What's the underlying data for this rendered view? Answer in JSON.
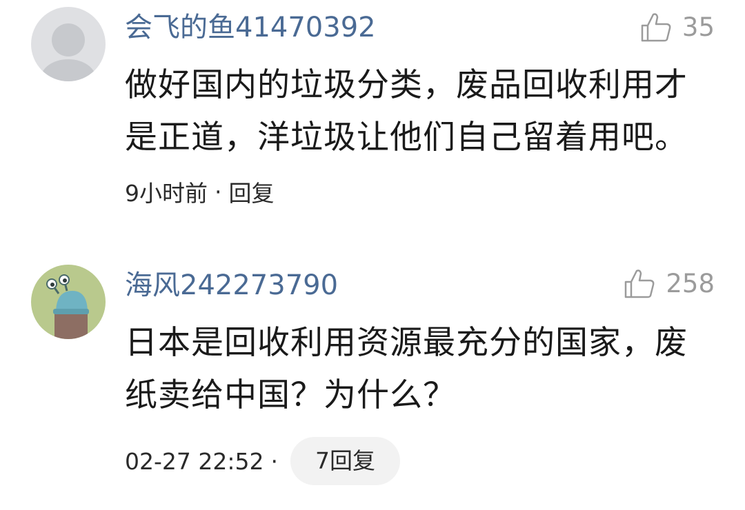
{
  "comments": [
    {
      "username": "会飞的鱼41470392",
      "likes": "35",
      "text_lines": [
        "做好国内的垃圾分类，废品回收利用才",
        "是正道，洋垃圾让他们自己留着用吧。"
      ],
      "time": "9小时前",
      "dot": "·",
      "reply_label": "回复",
      "avatar_icon": "default-avatar-icon"
    },
    {
      "username": "海风242273790",
      "likes": "258",
      "text_lines": [
        "日本是回收利用资源最充分的国家，废",
        "纸卖给中国？为什么？"
      ],
      "time": "02-27 22:52",
      "dot": "·",
      "reply_label": "7回复",
      "avatar_icon": "cartoon-avatar-icon"
    }
  ],
  "colors": {
    "username": "#4a6a94",
    "like": "#9b9b9b",
    "text": "#1a1a1a",
    "pill_bg": "#f2f2f2"
  }
}
